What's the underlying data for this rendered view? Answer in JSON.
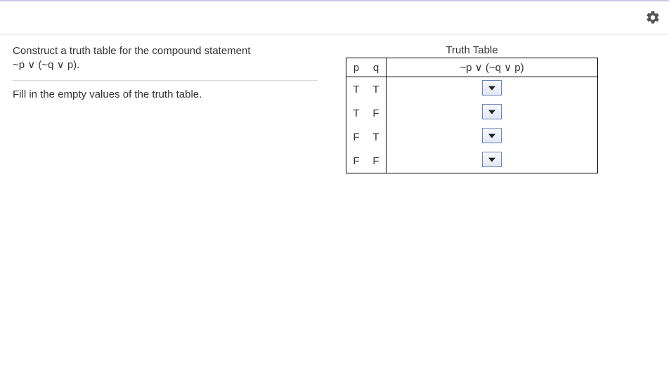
{
  "instructions": {
    "line1": "Construct a truth table for the compound statement",
    "expression": "~p ∨ (~q ∨ p).",
    "line2": "Fill in the empty values of the truth table."
  },
  "table": {
    "title": "Truth Table",
    "headers": {
      "p": "p",
      "q": "q",
      "expr": "~p ∨ (~q ∨ p)"
    },
    "rows": [
      {
        "p": "T",
        "q": "T",
        "result": ""
      },
      {
        "p": "T",
        "q": "F",
        "result": ""
      },
      {
        "p": "F",
        "q": "T",
        "result": ""
      },
      {
        "p": "F",
        "q": "F",
        "result": ""
      }
    ]
  },
  "icons": {
    "gear": "settings"
  }
}
